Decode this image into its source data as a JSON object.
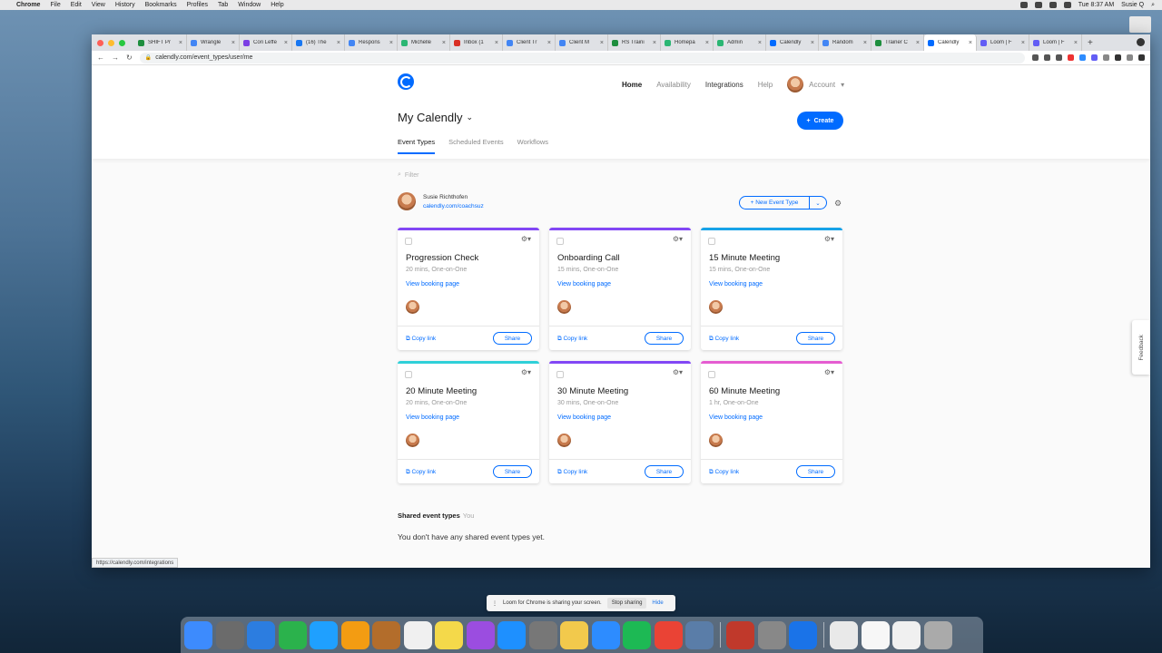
{
  "menubar": {
    "app": "Chrome",
    "items": [
      "File",
      "Edit",
      "View",
      "History",
      "Bookmarks",
      "Profiles",
      "Tab",
      "Window",
      "Help"
    ],
    "clock": "Tue 8:37 AM",
    "user": "Susie Q"
  },
  "browser": {
    "tabs": [
      {
        "title": "SHIFT Pr",
        "color": "#1e8e3e"
      },
      {
        "title": "Wrangle",
        "color": "#4285f4"
      },
      {
        "title": "Cori Leffe",
        "color": "#7b3fe4"
      },
      {
        "title": "(16) The",
        "color": "#1877f2"
      },
      {
        "title": "Respons",
        "color": "#4285f4"
      },
      {
        "title": "Michelle",
        "color": "#2bb673"
      },
      {
        "title": "Inbox (1",
        "color": "#d93025"
      },
      {
        "title": "Client Tr",
        "color": "#4285f4"
      },
      {
        "title": "Client M",
        "color": "#4285f4"
      },
      {
        "title": "RS Traini",
        "color": "#1e8e3e"
      },
      {
        "title": "Homepa",
        "color": "#2bb673"
      },
      {
        "title": "Admin",
        "color": "#2bb673"
      },
      {
        "title": "Calendly",
        "color": "#006bff"
      },
      {
        "title": "Random",
        "color": "#4285f4"
      },
      {
        "title": "Trainer C",
        "color": "#1e8e3e"
      },
      {
        "title": "Calendly",
        "color": "#006bff",
        "active": true
      },
      {
        "title": "Loom | F",
        "color": "#625df5"
      },
      {
        "title": "Loom | F",
        "color": "#625df5"
      }
    ],
    "url": "calendly.com/event_types/user/me",
    "status_url": "https://calendly.com/integrations"
  },
  "nav": {
    "home": "Home",
    "availability": "Availability",
    "integrations": "Integrations",
    "help": "Help",
    "account": "Account"
  },
  "page": {
    "title": "My Calendly",
    "create_label": "Create",
    "tabs": {
      "event_types": "Event Types",
      "scheduled": "Scheduled Events",
      "workflows": "Workflows"
    },
    "filter_placeholder": "Filter",
    "user_name": "Susie Richthofen",
    "user_link": "calendly.com/coachsuz",
    "new_event_label": "New Event Type",
    "shared_title": "Shared event types",
    "shared_you": "You",
    "no_shared": "You don't have any shared event types yet."
  },
  "cards": [
    {
      "title": "Progression Check",
      "meta": "20 mins, One-on-One",
      "color": "#8247f5"
    },
    {
      "title": "Onboarding Call",
      "meta": "15 mins, One-on-One",
      "color": "#8247f5"
    },
    {
      "title": "15 Minute Meeting",
      "meta": "15 mins, One-on-One",
      "color": "#17a2e8"
    },
    {
      "title": "20 Minute Meeting",
      "meta": "20 mins, One-on-One",
      "color": "#2fd0d8"
    },
    {
      "title": "30 Minute Meeting",
      "meta": "30 mins, One-on-One",
      "color": "#8247f5"
    },
    {
      "title": "60 Minute Meeting",
      "meta": "1 hr, One-on-One",
      "color": "#e55cd1"
    }
  ],
  "card_labels": {
    "view": "View booking page",
    "copy": "Copy link",
    "share": "Share"
  },
  "feedback": "Feedback",
  "loom": {
    "message": "Loom for Chrome is sharing your screen.",
    "stop": "Stop sharing",
    "hide": "Hide"
  },
  "dock_colors": [
    "#3d8bfd",
    "#6b6b6b",
    "#2c7de0",
    "#2bb24c",
    "#1fa0ff",
    "#f39c12",
    "#b36d2b",
    "#f0f0f0",
    "#f4d94a",
    "#9b4de0",
    "#1e90ff",
    "#777",
    "#f2c94c",
    "#2d8cff",
    "#1db954",
    "#ea4335",
    "#5a7da8",
    "#c0392b",
    "#888",
    "#1a73e8",
    "#e9e9e9",
    "#f7f7f7",
    "#f0f0f0",
    "#aaa"
  ]
}
